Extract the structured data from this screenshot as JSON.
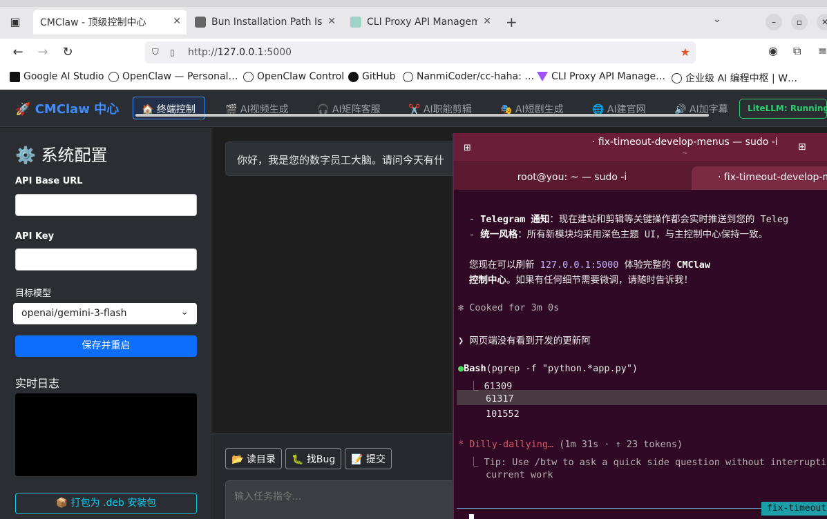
{
  "browser": {
    "tabs": [
      {
        "title": "CMClaw - 顶级控制中心",
        "icon_color": "#ffffff"
      },
      {
        "title": "Bun Installation Path Issu",
        "icon_color": "#666666"
      },
      {
        "title": "CLI Proxy API Managemer",
        "icon_color": "#9fd3c7"
      }
    ],
    "tab_close_glyph": "✕",
    "url_host": "127.0.0.1",
    "url_port": ":5000",
    "url_scheme": "http://",
    "bookmarks": [
      "Google AI Studio",
      "OpenClaw — Personal…",
      "OpenClaw Control",
      "GitHub",
      "NanmiCoder/cc-haha: …",
      "CLI Proxy API Manage…",
      "企业级 AI 编程中枢 | W…"
    ]
  },
  "app": {
    "brand": "🚀 CMClaw 中心",
    "nav": [
      "🏠 终端控制",
      "🎬 AI视频生成",
      "🎧 AI矩阵客服",
      "✂️ AI职能剪辑",
      "🎭 AI短剧生成",
      "🌐 AI建官网",
      "🔊 AI加字幕"
    ],
    "status_badge": "LiteLLM: Running",
    "colors": {
      "accent": "#0d6efd",
      "running": "#2ecc71",
      "deb": "#0dcaf0"
    }
  },
  "sidebar": {
    "title": "⚙️ 系统配置",
    "api_base_label": "API Base URL",
    "api_base_value": "",
    "api_key_label": "API Key",
    "api_key_value": "",
    "model_label": "目标模型",
    "model_value": "openai/gemini-3-flash",
    "save_label": "保存并重启",
    "log_title": "实时日志",
    "deb_label": "📦 打包为 .deb 安装包"
  },
  "main": {
    "greeting": "你好，我是您的数字员工大脑。请问今天有什",
    "quick_buttons": [
      "📂 读目录",
      "🐛 找Bug",
      "📝 提交"
    ],
    "task_placeholder": "输入任务指令..."
  },
  "terminal": {
    "title": "· fix-timeout-develop-menus — sudo -i",
    "subtitle": "~",
    "tab1": "root@you: ~ — sudo -i",
    "tab2": "· fix-timeout-develop-m",
    "lines": {
      "l1_bold": "Telegram 通知",
      "l1_rest": "：现在建站和剪辑等关键操作都会实时推送到您的 Teleg",
      "l2_bold": "统一风格",
      "l2_rest": "：所有新模块均采用深色主题 UI，与主控制中心保持一致。",
      "l3_pre": "您现在可以刷新 ",
      "l3_host": "127.0.0.1:5000",
      "l3_mid": " 体验完整的 ",
      "l3_bold": "CMClaw",
      "l4_bold": "控制中心",
      "l4_rest": "。如果有任何细节需要微调，请随时告诉我！",
      "cooked": "✻ Cooked for 3m 0s",
      "prompt": "❯ 网页端没有看到开发的更新阿",
      "bash_name": "Bash",
      "bash_args": "(pgrep -f \"python.*app.py\")",
      "pid1": "61309",
      "pid2": "61317",
      "pid3": "101552",
      "dilly": "* Dilly-dallying…",
      "dilly_meta": " (1m 31s · ↑ 23 tokens)",
      "tip1": "⎿ Tip: Use /btw to ask a quick side question without interruptin",
      "tip2": "current work"
    },
    "status_tag": "fix-timeout"
  }
}
